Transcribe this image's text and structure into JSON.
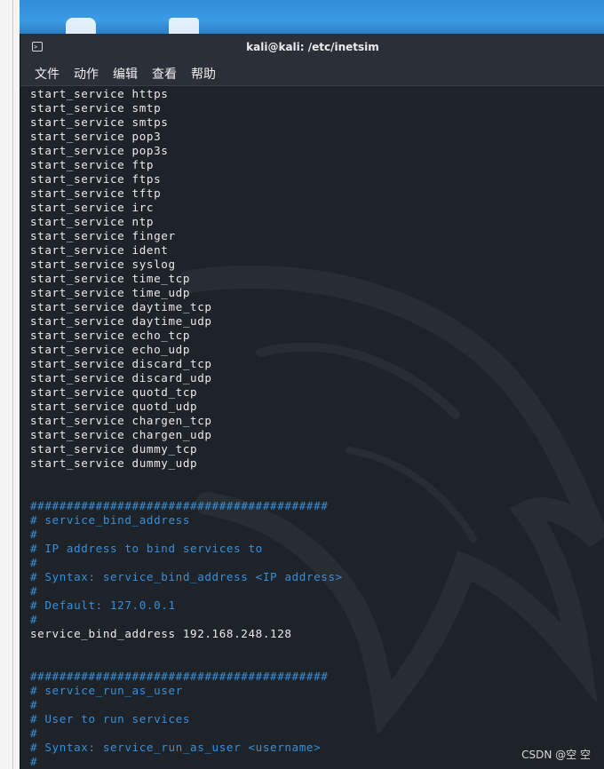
{
  "window": {
    "title": "kali@kali: /etc/inetsim"
  },
  "menu": [
    "文件",
    "动作",
    "编辑",
    "查看",
    "帮助"
  ],
  "terminal": {
    "lines": [
      {
        "text": "start_service https",
        "kind": "normal"
      },
      {
        "text": "start_service smtp",
        "kind": "normal"
      },
      {
        "text": "start_service smtps",
        "kind": "normal"
      },
      {
        "text": "start_service pop3",
        "kind": "normal"
      },
      {
        "text": "start_service pop3s",
        "kind": "normal"
      },
      {
        "text": "start_service ftp",
        "kind": "normal"
      },
      {
        "text": "start_service ftps",
        "kind": "normal"
      },
      {
        "text": "start_service tftp",
        "kind": "normal"
      },
      {
        "text": "start_service irc",
        "kind": "normal"
      },
      {
        "text": "start_service ntp",
        "kind": "normal"
      },
      {
        "text": "start_service finger",
        "kind": "normal"
      },
      {
        "text": "start_service ident",
        "kind": "normal"
      },
      {
        "text": "start_service syslog",
        "kind": "normal"
      },
      {
        "text": "start_service time_tcp",
        "kind": "normal"
      },
      {
        "text": "start_service time_udp",
        "kind": "normal"
      },
      {
        "text": "start_service daytime_tcp",
        "kind": "normal"
      },
      {
        "text": "start_service daytime_udp",
        "kind": "normal"
      },
      {
        "text": "start_service echo_tcp",
        "kind": "normal"
      },
      {
        "text": "start_service echo_udp",
        "kind": "normal"
      },
      {
        "text": "start_service discard_tcp",
        "kind": "normal"
      },
      {
        "text": "start_service discard_udp",
        "kind": "normal"
      },
      {
        "text": "start_service quotd_tcp",
        "kind": "normal"
      },
      {
        "text": "start_service quotd_udp",
        "kind": "normal"
      },
      {
        "text": "start_service chargen_tcp",
        "kind": "normal"
      },
      {
        "text": "start_service chargen_udp",
        "kind": "normal"
      },
      {
        "text": "start_service dummy_tcp",
        "kind": "normal"
      },
      {
        "text": "start_service dummy_udp",
        "kind": "normal"
      },
      {
        "text": "",
        "kind": "normal"
      },
      {
        "text": "",
        "kind": "normal"
      },
      {
        "text": "#########################################",
        "kind": "comment"
      },
      {
        "text": "# service_bind_address",
        "kind": "comment"
      },
      {
        "text": "#",
        "kind": "comment"
      },
      {
        "text": "# IP address to bind services to",
        "kind": "comment"
      },
      {
        "text": "#",
        "kind": "comment"
      },
      {
        "text": "# Syntax: service_bind_address <IP address>",
        "kind": "comment"
      },
      {
        "text": "#",
        "kind": "comment"
      },
      {
        "text": "# Default: 127.0.0.1",
        "kind": "comment"
      },
      {
        "text": "#",
        "kind": "comment"
      },
      {
        "text": "service_bind_address 192.168.248.128",
        "kind": "normal"
      },
      {
        "text": "",
        "kind": "normal"
      },
      {
        "text": "",
        "kind": "normal"
      },
      {
        "text": "#########################################",
        "kind": "comment"
      },
      {
        "text": "# service_run_as_user",
        "kind": "comment"
      },
      {
        "text": "#",
        "kind": "comment"
      },
      {
        "text": "# User to run services",
        "kind": "comment"
      },
      {
        "text": "#",
        "kind": "comment"
      },
      {
        "text": "# Syntax: service_run_as_user <username>",
        "kind": "comment"
      },
      {
        "text": "#",
        "kind": "comment"
      }
    ]
  },
  "watermark": "CSDN @空 空",
  "colors": {
    "comment": "#3a8fd6",
    "normal": "#eaeaea",
    "background": "#1e2229"
  },
  "icons": [
    "terminal-icon"
  ]
}
